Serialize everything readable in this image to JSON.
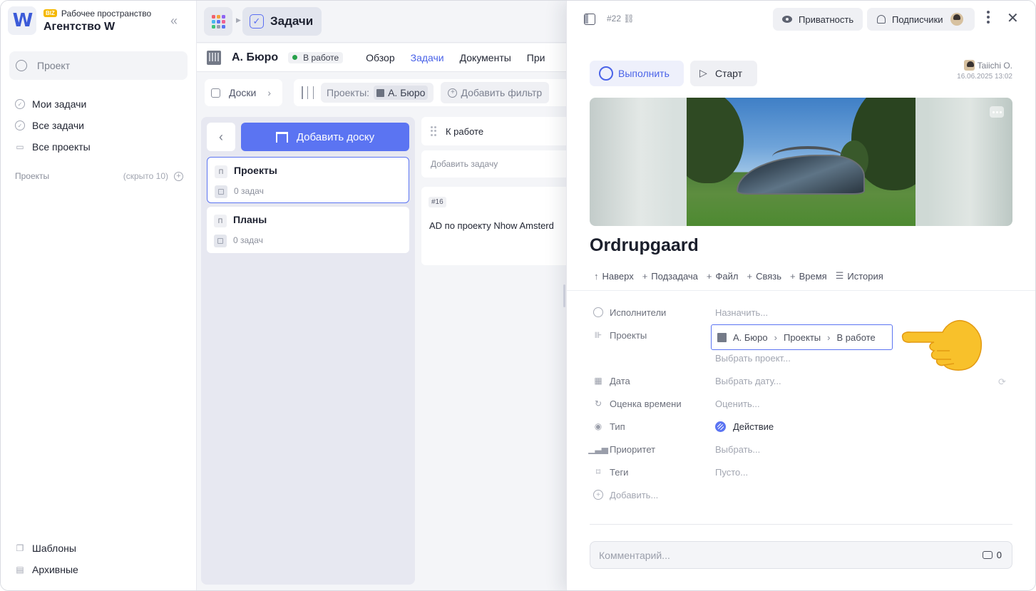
{
  "sidebar": {
    "workspace_badge": "BIZ",
    "workspace_caption": "Рабочее пространство",
    "workspace_name": "Агентство W",
    "search_placeholder": "Проект",
    "nav": [
      {
        "label": "Мои задачи",
        "icon": "check-circle-icon"
      },
      {
        "label": "Все задачи",
        "icon": "check-circle-icon"
      },
      {
        "label": "Все проекты",
        "icon": "folder-icon"
      }
    ],
    "projects_header": "Проекты",
    "projects_hidden": "(скрыто 10)",
    "bottom_nav": [
      {
        "label": "Шаблоны",
        "icon": "templates-icon"
      },
      {
        "label": "Архивные",
        "icon": "archive-icon"
      }
    ]
  },
  "topbar": {
    "section_title": "Задачи"
  },
  "project": {
    "name": "А. Бюро",
    "status": "В работе",
    "status_color": "#26a04a",
    "tabs": [
      {
        "label": "Обзор",
        "active": false
      },
      {
        "label": "Задачи",
        "active": true
      },
      {
        "label": "Документы",
        "active": false
      },
      {
        "label": "При",
        "active": false
      }
    ]
  },
  "filters": {
    "boards_label": "Доски",
    "projects_label": "Проекты:",
    "projects_value": "А. Бюро",
    "add_filter": "Добавить фильтр"
  },
  "boards": {
    "add_label": "Добавить доску",
    "items": [
      {
        "letter": "П",
        "title": "Проекты",
        "count": "0 задач",
        "selected": true
      },
      {
        "letter": "П",
        "title": "Планы",
        "count": "0 задач",
        "selected": false
      }
    ]
  },
  "column": {
    "title": "К работе",
    "add_task": "Добавить задачу",
    "task_id": "#16",
    "task_title": "AD по проекту Nhow Amsterd"
  },
  "detail": {
    "id": "#22",
    "privacy": "Приватность",
    "subscribers": "Подписчики",
    "done": "Выполнить",
    "start": "Старт",
    "author": "Taiichi O.",
    "date": "16.06.2025 13:02",
    "title": "Ordrupgaard",
    "actions": [
      {
        "icon": "↑",
        "label": "Наверх"
      },
      {
        "icon": "+",
        "label": "Подзадача"
      },
      {
        "icon": "+",
        "label": "Файл"
      },
      {
        "icon": "+",
        "label": "Связь"
      },
      {
        "icon": "+",
        "label": "Время"
      },
      {
        "icon": "☰",
        "label": "История"
      }
    ],
    "props": {
      "assignees_label": "Исполнители",
      "assignees_value": "Назначить...",
      "projects_label": "Проекты",
      "projects_path": [
        "А. Бюро",
        "Проекты",
        "В работе"
      ],
      "pick_project": "Выбрать проект...",
      "date_label": "Дата",
      "date_value": "Выбрать дату...",
      "estimate_label": "Оценка времени",
      "estimate_value": "Оценить...",
      "type_label": "Тип",
      "type_value": "Действие",
      "priority_label": "Приоритет",
      "priority_value": "Выбрать...",
      "tags_label": "Теги",
      "tags_value": "Пусто...",
      "add_label": "Добавить..."
    },
    "comment_placeholder": "Комментарий...",
    "comment_count": "0"
  },
  "colors": {
    "accent": "#5b74f2",
    "accent_text": "#4a63e8"
  }
}
